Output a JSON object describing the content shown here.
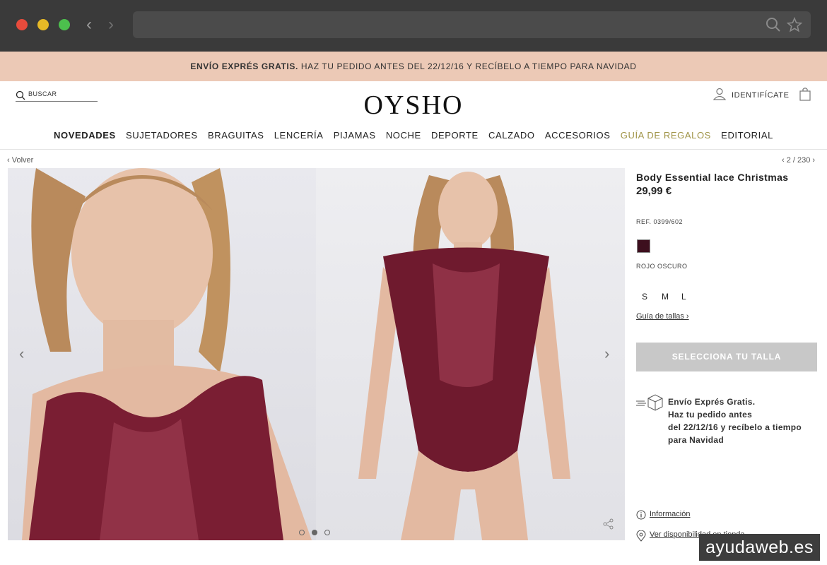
{
  "browser": {
    "back_arrow": "‹",
    "forward_arrow": "›"
  },
  "promo": {
    "bold": "ENVÍO EXPRÉS GRATIS.",
    "text": " HAZ TU PEDIDO ANTES DEL 22/12/16 Y RECÍBELO A TIEMPO PARA NAVIDAD"
  },
  "header": {
    "search_label": "BUSCAR",
    "logo": "OYSHO",
    "login_label": "IDENTIFÍCATE"
  },
  "menu": {
    "items": [
      "NOVEDADES",
      "SUJETADORES",
      "BRAGUITAS",
      "LENCERÍA",
      "PIJAMAS",
      "NOCHE",
      "DEPORTE",
      "CALZADO",
      "ACCESORIOS",
      "GUÍA DE REGALOS",
      "EDITORIAL"
    ]
  },
  "breadcrumb": {
    "back_label": "‹ Volver",
    "pager": "‹ 2 / 230 ›"
  },
  "gallery": {
    "prev": "‹",
    "next": "›"
  },
  "product": {
    "title": "Body Essential lace Christmas",
    "price": "29,99 €",
    "ref": "REF. 0399/602",
    "color_hex": "#3d0f1e",
    "color_name": "ROJO OSCURO",
    "sizes": [
      "S",
      "M",
      "L"
    ],
    "size_guide": "Guía de tallas ›",
    "cta": "SELECCIONA TU TALLA",
    "shipping_lines": [
      "Envío Exprés Gratis.",
      "Haz tu pedido antes",
      "del 22/12/16 y recíbelo a tiempo",
      "para Navidad"
    ],
    "info_link": "Información",
    "store_link": "Ver disponibilidad en tienda"
  },
  "watermark": "ayudaweb.es",
  "colors": {
    "promo_bg": "#ecc9b6",
    "gold": "#a09447",
    "chrome": "#3a3a3a",
    "cta_bg": "#c8c8c8"
  }
}
